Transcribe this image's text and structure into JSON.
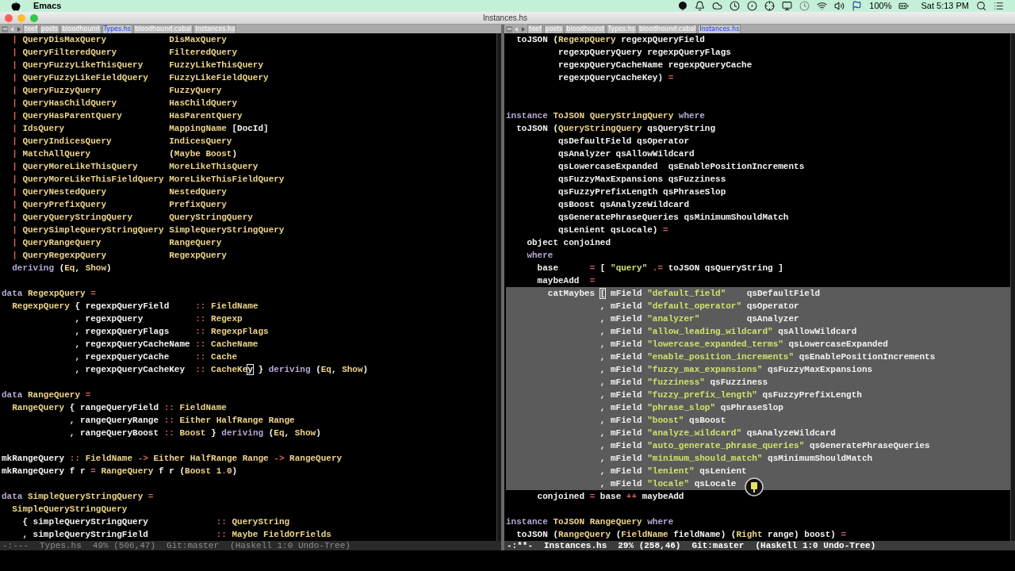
{
  "menu_bar": {
    "app_name": "Emacs",
    "battery": "100%",
    "clock": "Sat 5:13 PM"
  },
  "window": {
    "title": "Instances.hs"
  },
  "panes": [
    {
      "active": false,
      "tabs": [
        {
          "label": "teef",
          "selected": false
        },
        {
          "label": "posts",
          "selected": false
        },
        {
          "label": "bloodhound",
          "selected": false
        },
        {
          "label": "Types.hs",
          "selected": true
        },
        {
          "label": "bloodhound.cabal",
          "selected": false
        },
        {
          "label": "Instances.hs",
          "selected": false
        }
      ],
      "lines": [
        {
          "kind": "code",
          "tokens": [
            {
              "kind": "op",
              "text": "  | "
            },
            {
              "kind": "type",
              "text": "QueryDisMaxQuery            DisMaxQuery"
            }
          ]
        },
        {
          "kind": "code",
          "tokens": [
            {
              "kind": "op",
              "text": "  | "
            },
            {
              "kind": "type",
              "text": "QueryFilteredQuery          FilteredQuery"
            }
          ]
        },
        {
          "kind": "code",
          "tokens": [
            {
              "kind": "op",
              "text": "  | "
            },
            {
              "kind": "type",
              "text": "QueryFuzzyLikeThisQuery     FuzzyLikeThisQuery"
            }
          ]
        },
        {
          "kind": "code",
          "tokens": [
            {
              "kind": "op",
              "text": "  | "
            },
            {
              "kind": "type",
              "text": "QueryFuzzyLikeFieldQuery    FuzzyLikeFieldQuery"
            }
          ]
        },
        {
          "kind": "code",
          "tokens": [
            {
              "kind": "op",
              "text": "  | "
            },
            {
              "kind": "type",
              "text": "QueryFuzzyQuery             FuzzyQuery"
            }
          ]
        },
        {
          "kind": "code",
          "tokens": [
            {
              "kind": "op",
              "text": "  | "
            },
            {
              "kind": "type",
              "text": "QueryHasChildQuery          HasChildQuery"
            }
          ]
        },
        {
          "kind": "code",
          "tokens": [
            {
              "kind": "op",
              "text": "  | "
            },
            {
              "kind": "type",
              "text": "QueryHasParentQuery         HasParentQuery"
            }
          ]
        },
        {
          "kind": "code",
          "tokens": [
            {
              "kind": "op",
              "text": "  | "
            },
            {
              "kind": "type",
              "text": "IdsQuery                    MappingName"
            },
            {
              "kind": "plain",
              "text": " [DocId]"
            }
          ]
        },
        {
          "kind": "code",
          "tokens": [
            {
              "kind": "op",
              "text": "  | "
            },
            {
              "kind": "type",
              "text": "QueryIndicesQuery           IndicesQuery"
            }
          ]
        },
        {
          "kind": "code",
          "tokens": [
            {
              "kind": "op",
              "text": "  | "
            },
            {
              "kind": "type",
              "text": "MatchAllQuery               "
            },
            {
              "kind": "plain",
              "text": "("
            },
            {
              "kind": "type",
              "text": "Maybe Boost"
            },
            {
              "kind": "plain",
              "text": ")"
            }
          ]
        },
        {
          "kind": "code",
          "tokens": [
            {
              "kind": "op",
              "text": "  | "
            },
            {
              "kind": "type",
              "text": "QueryMoreLikeThisQuery      MoreLikeThisQuery"
            }
          ]
        },
        {
          "kind": "code",
          "tokens": [
            {
              "kind": "op",
              "text": "  | "
            },
            {
              "kind": "type",
              "text": "QueryMoreLikeThisFieldQuery MoreLikeThisFieldQuery"
            }
          ]
        },
        {
          "kind": "code",
          "tokens": [
            {
              "kind": "op",
              "text": "  | "
            },
            {
              "kind": "type",
              "text": "QueryNestedQuery            NestedQuery"
            }
          ]
        },
        {
          "kind": "code",
          "tokens": [
            {
              "kind": "op",
              "text": "  | "
            },
            {
              "kind": "type",
              "text": "QueryPrefixQuery            PrefixQuery"
            }
          ]
        },
        {
          "kind": "code",
          "tokens": [
            {
              "kind": "op",
              "text": "  | "
            },
            {
              "kind": "type",
              "text": "QueryQueryStringQuery       QueryStringQuery"
            }
          ]
        },
        {
          "kind": "code",
          "tokens": [
            {
              "kind": "op",
              "text": "  | "
            },
            {
              "kind": "type",
              "text": "QuerySimpleQueryStringQuery SimpleQueryStringQuery"
            }
          ]
        },
        {
          "kind": "code",
          "tokens": [
            {
              "kind": "op",
              "text": "  | "
            },
            {
              "kind": "type",
              "text": "QueryRangeQuery             RangeQuery"
            }
          ]
        },
        {
          "kind": "code",
          "tokens": [
            {
              "kind": "op",
              "text": "  | "
            },
            {
              "kind": "type",
              "text": "QueryRegexpQuery            RegexpQuery"
            }
          ]
        },
        {
          "kind": "code",
          "tokens": [
            {
              "kind": "keyword",
              "text": "  deriving "
            },
            {
              "kind": "plain",
              "text": "("
            },
            {
              "kind": "type",
              "text": "Eq"
            },
            {
              "kind": "plain",
              "text": ", "
            },
            {
              "kind": "type",
              "text": "Show"
            },
            {
              "kind": "plain",
              "text": ")"
            }
          ]
        },
        {
          "kind": "blank"
        },
        {
          "kind": "code",
          "tokens": [
            {
              "kind": "keyword",
              "text": "data "
            },
            {
              "kind": "type",
              "text": "RegexpQuery"
            },
            {
              "kind": "op",
              "text": " ="
            }
          ]
        },
        {
          "kind": "code",
          "tokens": [
            {
              "kind": "type",
              "text": "  RegexpQuery"
            },
            {
              "kind": "plain",
              "text": " { regexpQueryField     "
            },
            {
              "kind": "op",
              "text": ":: "
            },
            {
              "kind": "type",
              "text": "FieldName"
            }
          ]
        },
        {
          "kind": "code",
          "tokens": [
            {
              "kind": "plain",
              "text": "              , regexpQuery          "
            },
            {
              "kind": "op",
              "text": ":: "
            },
            {
              "kind": "type",
              "text": "Regexp"
            }
          ]
        },
        {
          "kind": "code",
          "tokens": [
            {
              "kind": "plain",
              "text": "              , regexpQueryFlags     "
            },
            {
              "kind": "op",
              "text": ":: "
            },
            {
              "kind": "type",
              "text": "RegexpFlags"
            }
          ]
        },
        {
          "kind": "code",
          "tokens": [
            {
              "kind": "plain",
              "text": "              , regexpQueryCacheName "
            },
            {
              "kind": "op",
              "text": ":: "
            },
            {
              "kind": "type",
              "text": "CacheName"
            }
          ]
        },
        {
          "kind": "code",
          "tokens": [
            {
              "kind": "plain",
              "text": "              , regexpQueryCache     "
            },
            {
              "kind": "op",
              "text": ":: "
            },
            {
              "kind": "type",
              "text": "Cache"
            }
          ]
        },
        {
          "kind": "code",
          "tokens": [
            {
              "kind": "plain",
              "text": "              , regexpQueryCacheKey  "
            },
            {
              "kind": "op",
              "text": ":: "
            },
            {
              "kind": "type",
              "text": "CacheKe"
            },
            {
              "kind": "cursor",
              "text": "y"
            },
            {
              "kind": "plain",
              "text": " } "
            },
            {
              "kind": "keyword",
              "text": "deriving "
            },
            {
              "kind": "plain",
              "text": "("
            },
            {
              "kind": "type",
              "text": "Eq"
            },
            {
              "kind": "plain",
              "text": ", "
            },
            {
              "kind": "type",
              "text": "Show"
            },
            {
              "kind": "plain",
              "text": ")"
            }
          ]
        },
        {
          "kind": "blank"
        },
        {
          "kind": "code",
          "tokens": [
            {
              "kind": "keyword",
              "text": "data "
            },
            {
              "kind": "type",
              "text": "RangeQuery"
            },
            {
              "kind": "op",
              "text": " ="
            }
          ]
        },
        {
          "kind": "code",
          "tokens": [
            {
              "kind": "type",
              "text": "  RangeQuery"
            },
            {
              "kind": "plain",
              "text": " { rangeQueryField "
            },
            {
              "kind": "op",
              "text": ":: "
            },
            {
              "kind": "type",
              "text": "FieldName"
            }
          ]
        },
        {
          "kind": "code",
          "tokens": [
            {
              "kind": "plain",
              "text": "             , rangeQueryRange "
            },
            {
              "kind": "op",
              "text": ":: "
            },
            {
              "kind": "type",
              "text": "Either HalfRange Range"
            }
          ]
        },
        {
          "kind": "code",
          "tokens": [
            {
              "kind": "plain",
              "text": "             , rangeQueryBoost "
            },
            {
              "kind": "op",
              "text": ":: "
            },
            {
              "kind": "type",
              "text": "Boost"
            },
            {
              "kind": "plain",
              "text": " } "
            },
            {
              "kind": "keyword",
              "text": "deriving "
            },
            {
              "kind": "plain",
              "text": "("
            },
            {
              "kind": "type",
              "text": "Eq"
            },
            {
              "kind": "plain",
              "text": ", "
            },
            {
              "kind": "type",
              "text": "Show"
            },
            {
              "kind": "plain",
              "text": ")"
            }
          ]
        },
        {
          "kind": "blank"
        },
        {
          "kind": "code",
          "tokens": [
            {
              "kind": "plain",
              "text": "mkRangeQuery "
            },
            {
              "kind": "op",
              "text": ":: "
            },
            {
              "kind": "type",
              "text": "FieldName "
            },
            {
              "kind": "op",
              "text": "-> "
            },
            {
              "kind": "type",
              "text": "Either HalfRange Range "
            },
            {
              "kind": "op",
              "text": "-> "
            },
            {
              "kind": "type",
              "text": "RangeQuery"
            }
          ]
        },
        {
          "kind": "code",
          "tokens": [
            {
              "kind": "plain",
              "text": "mkRangeQuery f r "
            },
            {
              "kind": "op",
              "text": "= "
            },
            {
              "kind": "type",
              "text": "RangeQuery"
            },
            {
              "kind": "plain",
              "text": " f r ("
            },
            {
              "kind": "type",
              "text": "Boost 1"
            },
            {
              "kind": "op",
              "text": "."
            },
            {
              "kind": "type",
              "text": "0"
            },
            {
              "kind": "plain",
              "text": ")"
            }
          ]
        },
        {
          "kind": "blank"
        },
        {
          "kind": "code",
          "tokens": [
            {
              "kind": "keyword",
              "text": "data "
            },
            {
              "kind": "type",
              "text": "SimpleQueryStringQuery"
            },
            {
              "kind": "op",
              "text": " ="
            }
          ]
        },
        {
          "kind": "code",
          "tokens": [
            {
              "kind": "type",
              "text": "  SimpleQueryStringQuery"
            }
          ]
        },
        {
          "kind": "code",
          "tokens": [
            {
              "kind": "plain",
              "text": "    { simpleQueryStringQuery             "
            },
            {
              "kind": "op",
              "text": ":: "
            },
            {
              "kind": "type",
              "text": "QueryString"
            }
          ]
        },
        {
          "kind": "code",
          "tokens": [
            {
              "kind": "plain",
              "text": "    , simpleQueryStringField             "
            },
            {
              "kind": "op",
              "text": ":: "
            },
            {
              "kind": "type",
              "text": "Maybe FieldOrFields"
            }
          ]
        }
      ],
      "mode_line": {
        "state": "-:---",
        "buffer": "Types.hs",
        "position": "49% (506,47)",
        "vc": "Git:master",
        "modes": "(Haskell 1:0 Undo-Tree)"
      }
    },
    {
      "active": true,
      "tabs": [
        {
          "label": "teef",
          "selected": false
        },
        {
          "label": "posts",
          "selected": false
        },
        {
          "label": "bloodhound",
          "selected": false
        },
        {
          "label": "Types.hs",
          "selected": false
        },
        {
          "label": "bloodhound.cabal",
          "selected": false
        },
        {
          "label": "Instances.hs",
          "selected": true
        }
      ],
      "lines": [
        {
          "kind": "code",
          "highlighted": false,
          "tokens": [
            {
              "kind": "plain",
              "text": "  toJSON ("
            },
            {
              "kind": "type",
              "text": "RegexpQuery"
            },
            {
              "kind": "plain",
              "text": " regexpQueryField"
            }
          ]
        },
        {
          "kind": "code",
          "highlighted": false,
          "tokens": [
            {
              "kind": "plain",
              "text": "          regexpQueryQuery regexpQueryFlags"
            }
          ]
        },
        {
          "kind": "code",
          "highlighted": false,
          "tokens": [
            {
              "kind": "plain",
              "text": "          regexpQueryCacheName regexpQueryCache"
            }
          ]
        },
        {
          "kind": "code",
          "highlighted": false,
          "tokens": [
            {
              "kind": "plain",
              "text": "          regexpQueryCacheKey) "
            },
            {
              "kind": "op",
              "text": "="
            }
          ]
        },
        {
          "kind": "blank",
          "highlighted": false
        },
        {
          "kind": "blank",
          "highlighted": false
        },
        {
          "kind": "code",
          "highlighted": false,
          "tokens": [
            {
              "kind": "keyword",
              "text": "instance "
            },
            {
              "kind": "type",
              "text": "ToJSON QueryStringQuery"
            },
            {
              "kind": "keyword",
              "text": " where"
            }
          ]
        },
        {
          "kind": "code",
          "highlighted": false,
          "tokens": [
            {
              "kind": "plain",
              "text": "  toJSON ("
            },
            {
              "kind": "type",
              "text": "QueryStringQuery"
            },
            {
              "kind": "plain",
              "text": " qsQueryString"
            }
          ]
        },
        {
          "kind": "code",
          "highlighted": false,
          "tokens": [
            {
              "kind": "plain",
              "text": "          qsDefaultField qsOperator"
            }
          ]
        },
        {
          "kind": "code",
          "highlighted": false,
          "tokens": [
            {
              "kind": "plain",
              "text": "          qsAnalyzer qsAllowWildcard"
            }
          ]
        },
        {
          "kind": "code",
          "highlighted": false,
          "tokens": [
            {
              "kind": "plain",
              "text": "          qsLowercaseExpanded  qsEnablePositionIncrements"
            }
          ]
        },
        {
          "kind": "code",
          "highlighted": false,
          "tokens": [
            {
              "kind": "plain",
              "text": "          qsFuzzyMaxExpansions qsFuzziness"
            }
          ]
        },
        {
          "kind": "code",
          "highlighted": false,
          "tokens": [
            {
              "kind": "plain",
              "text": "          qsFuzzyPrefixLength qsPhraseSlop"
            }
          ]
        },
        {
          "kind": "code",
          "highlighted": false,
          "tokens": [
            {
              "kind": "plain",
              "text": "          qsBoost qsAnalyzeWildcard"
            }
          ]
        },
        {
          "kind": "code",
          "highlighted": false,
          "tokens": [
            {
              "kind": "plain",
              "text": "          qsGeneratePhraseQueries qsMinimumShouldMatch"
            }
          ]
        },
        {
          "kind": "code",
          "highlighted": false,
          "tokens": [
            {
              "kind": "plain",
              "text": "          qsLenient qsLocale) "
            },
            {
              "kind": "op",
              "text": "="
            }
          ]
        },
        {
          "kind": "code",
          "highlighted": false,
          "tokens": [
            {
              "kind": "plain",
              "text": "    object conjoined"
            }
          ]
        },
        {
          "kind": "code",
          "highlighted": false,
          "tokens": [
            {
              "kind": "keyword",
              "text": "    where"
            }
          ]
        },
        {
          "kind": "code",
          "highlighted": false,
          "tokens": [
            {
              "kind": "plain",
              "text": "      base      "
            },
            {
              "kind": "op",
              "text": "= "
            },
            {
              "kind": "plain",
              "text": "[ "
            },
            {
              "kind": "string",
              "text": "\"query\""
            },
            {
              "kind": "op",
              "text": " .= "
            },
            {
              "kind": "plain",
              "text": "toJSON qsQueryString ]"
            }
          ]
        },
        {
          "kind": "code",
          "highlighted": false,
          "tokens": [
            {
              "kind": "plain",
              "text": "      maybeAdd  "
            },
            {
              "kind": "op",
              "text": "="
            }
          ]
        },
        {
          "kind": "code",
          "highlighted": true,
          "tokens": [
            {
              "kind": "plain",
              "text": "        catMaybes "
            },
            {
              "kind": "cursor",
              "text": "["
            },
            {
              "kind": "plain",
              "text": " mField "
            },
            {
              "kind": "string",
              "text": "\"default_field\""
            },
            {
              "kind": "plain",
              "text": "    qsDefaultField"
            }
          ]
        },
        {
          "kind": "code",
          "highlighted": true,
          "tokens": [
            {
              "kind": "plain",
              "text": "                  , mField "
            },
            {
              "kind": "string",
              "text": "\"default_operator\""
            },
            {
              "kind": "plain",
              "text": " qsOperator"
            }
          ]
        },
        {
          "kind": "code",
          "highlighted": true,
          "tokens": [
            {
              "kind": "plain",
              "text": "                  , mField "
            },
            {
              "kind": "string",
              "text": "\"analyzer\""
            },
            {
              "kind": "plain",
              "text": "         qsAnalyzer"
            }
          ]
        },
        {
          "kind": "code",
          "highlighted": true,
          "tokens": [
            {
              "kind": "plain",
              "text": "                  , mField "
            },
            {
              "kind": "string",
              "text": "\"allow_leading_wildcard\""
            },
            {
              "kind": "plain",
              "text": " qsAllowWildcard"
            }
          ]
        },
        {
          "kind": "code",
          "highlighted": true,
          "tokens": [
            {
              "kind": "plain",
              "text": "                  , mField "
            },
            {
              "kind": "string",
              "text": "\"lowercase_expanded_terms\""
            },
            {
              "kind": "plain",
              "text": " qsLowercaseExpanded"
            }
          ]
        },
        {
          "kind": "code",
          "highlighted": true,
          "tokens": [
            {
              "kind": "plain",
              "text": "                  , mField "
            },
            {
              "kind": "string",
              "text": "\"enable_position_increments\""
            },
            {
              "kind": "plain",
              "text": " qsEnablePositionIncrements"
            }
          ]
        },
        {
          "kind": "code",
          "highlighted": true,
          "tokens": [
            {
              "kind": "plain",
              "text": "                  , mField "
            },
            {
              "kind": "string",
              "text": "\"fuzzy_max_expansions\""
            },
            {
              "kind": "plain",
              "text": " qsFuzzyMaxExpansions"
            }
          ]
        },
        {
          "kind": "code",
          "highlighted": true,
          "tokens": [
            {
              "kind": "plain",
              "text": "                  , mField "
            },
            {
              "kind": "string",
              "text": "\"fuzziness\""
            },
            {
              "kind": "plain",
              "text": " qsFuzziness"
            }
          ]
        },
        {
          "kind": "code",
          "highlighted": true,
          "tokens": [
            {
              "kind": "plain",
              "text": "                  , mField "
            },
            {
              "kind": "string",
              "text": "\"fuzzy_prefix_length\""
            },
            {
              "kind": "plain",
              "text": " qsFuzzyPrefixLength"
            }
          ]
        },
        {
          "kind": "code",
          "highlighted": true,
          "tokens": [
            {
              "kind": "plain",
              "text": "                  , mField "
            },
            {
              "kind": "string",
              "text": "\"phrase_slop\""
            },
            {
              "kind": "plain",
              "text": " qsPhraseSlop"
            }
          ]
        },
        {
          "kind": "code",
          "highlighted": true,
          "tokens": [
            {
              "kind": "plain",
              "text": "                  , mField "
            },
            {
              "kind": "string",
              "text": "\"boost\""
            },
            {
              "kind": "plain",
              "text": " qsBoost"
            }
          ]
        },
        {
          "kind": "code",
          "highlighted": true,
          "tokens": [
            {
              "kind": "plain",
              "text": "                  , mField "
            },
            {
              "kind": "string",
              "text": "\"analyze_wildcard\""
            },
            {
              "kind": "plain",
              "text": " qsAnalyzeWildcard"
            }
          ]
        },
        {
          "kind": "code",
          "highlighted": true,
          "tokens": [
            {
              "kind": "plain",
              "text": "                  , mField "
            },
            {
              "kind": "string",
              "text": "\"auto_generate_phrase_queries\""
            },
            {
              "kind": "plain",
              "text": " qsGeneratePhraseQueries"
            }
          ]
        },
        {
          "kind": "code",
          "highlighted": true,
          "tokens": [
            {
              "kind": "plain",
              "text": "                  , mField "
            },
            {
              "kind": "string",
              "text": "\"minimum_should_match\""
            },
            {
              "kind": "plain",
              "text": " qsMinimumShouldMatch"
            }
          ]
        },
        {
          "kind": "code",
          "highlighted": true,
          "tokens": [
            {
              "kind": "plain",
              "text": "                  , mField "
            },
            {
              "kind": "string",
              "text": "\"lenient\""
            },
            {
              "kind": "plain",
              "text": " qsLenient"
            }
          ]
        },
        {
          "kind": "code",
          "highlighted": true,
          "tokens": [
            {
              "kind": "plain",
              "text": "                  , mField "
            },
            {
              "kind": "string",
              "text": "\"locale\""
            },
            {
              "kind": "plain",
              "text": " qsLocale"
            }
          ]
        },
        {
          "kind": "code",
          "highlighted": false,
          "tokens": [
            {
              "kind": "plain",
              "text": "      conjoined "
            },
            {
              "kind": "op",
              "text": "= "
            },
            {
              "kind": "plain",
              "text": "base "
            },
            {
              "kind": "op",
              "text": "++ "
            },
            {
              "kind": "plain",
              "text": "maybeAdd"
            }
          ]
        },
        {
          "kind": "blank",
          "highlighted": false
        },
        {
          "kind": "code",
          "highlighted": false,
          "tokens": [
            {
              "kind": "keyword",
              "text": "instance "
            },
            {
              "kind": "type",
              "text": "ToJSON RangeQuery"
            },
            {
              "kind": "keyword",
              "text": " where"
            }
          ]
        },
        {
          "kind": "code",
          "highlighted": false,
          "tokens": [
            {
              "kind": "plain",
              "text": "  toJSON ("
            },
            {
              "kind": "type",
              "text": "RangeQuery"
            },
            {
              "kind": "plain",
              "text": " ("
            },
            {
              "kind": "type",
              "text": "FieldName"
            },
            {
              "kind": "plain",
              "text": " fieldName) ("
            },
            {
              "kind": "type",
              "text": "Right"
            },
            {
              "kind": "plain",
              "text": " range) boost) "
            },
            {
              "kind": "op",
              "text": "="
            }
          ]
        }
      ],
      "mode_line": {
        "state": "-:**-",
        "buffer": "Instances.hs",
        "position": "29% (258,46)",
        "vc": "Git:master",
        "modes": "(Haskell 1:0 Undo-Tree)"
      }
    }
  ]
}
